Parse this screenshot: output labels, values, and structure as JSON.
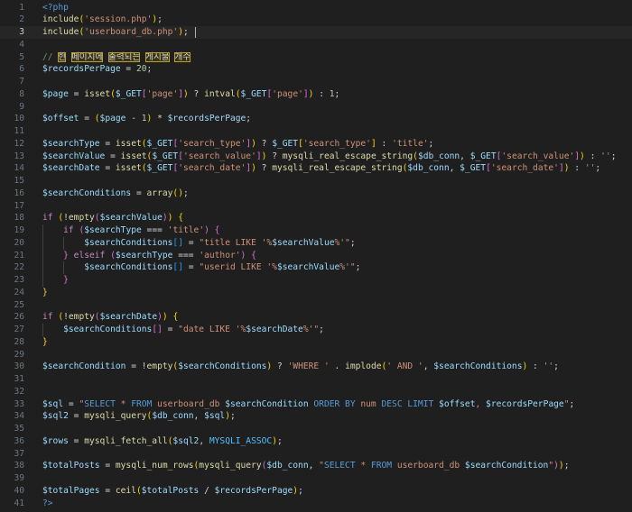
{
  "editor": {
    "language": "php",
    "current_line": 3,
    "line_count": 41,
    "lines": [
      [
        [
          "tag",
          "<?php"
        ]
      ],
      [
        [
          "fn",
          "include"
        ],
        [
          "br1",
          "("
        ],
        [
          "str",
          "'session.php'"
        ],
        [
          "br1",
          ")"
        ],
        [
          "op",
          ";"
        ]
      ],
      [
        [
          "fn",
          "include"
        ],
        [
          "br1",
          "("
        ],
        [
          "str",
          "'userboard_db.php'"
        ],
        [
          "br1",
          ")"
        ],
        [
          "op",
          ";"
        ]
      ],
      [],
      [
        [
          "cmt",
          "// "
        ],
        [
          "hl",
          "한"
        ],
        [
          "cmt",
          " "
        ],
        [
          "hl",
          "페이지에"
        ],
        [
          "cmt",
          " "
        ],
        [
          "hl",
          "출력되는"
        ],
        [
          "cmt",
          " "
        ],
        [
          "hl",
          "게시물"
        ],
        [
          "cmt",
          " "
        ],
        [
          "hl",
          "개수"
        ]
      ],
      [
        [
          "var",
          "$recordsPerPage"
        ],
        [
          "op",
          " = "
        ],
        [
          "num",
          "20"
        ],
        [
          "op",
          ";"
        ]
      ],
      [],
      [
        [
          "var",
          "$page"
        ],
        [
          "op",
          " = "
        ],
        [
          "fn",
          "isset"
        ],
        [
          "br1",
          "("
        ],
        [
          "var",
          "$_GET"
        ],
        [
          "br2",
          "["
        ],
        [
          "str",
          "'page'"
        ],
        [
          "br2",
          "]"
        ],
        [
          "br1",
          ")"
        ],
        [
          "op",
          " ? "
        ],
        [
          "fn",
          "intval"
        ],
        [
          "br1",
          "("
        ],
        [
          "var",
          "$_GET"
        ],
        [
          "br2",
          "["
        ],
        [
          "str",
          "'page'"
        ],
        [
          "br2",
          "]"
        ],
        [
          "br1",
          ")"
        ],
        [
          "op",
          " : "
        ],
        [
          "num",
          "1"
        ],
        [
          "op",
          ";"
        ]
      ],
      [],
      [
        [
          "var",
          "$offset"
        ],
        [
          "op",
          " = "
        ],
        [
          "br1",
          "("
        ],
        [
          "var",
          "$page"
        ],
        [
          "op",
          " - "
        ],
        [
          "num",
          "1"
        ],
        [
          "br1",
          ")"
        ],
        [
          "op",
          " * "
        ],
        [
          "var",
          "$recordsPerPage"
        ],
        [
          "op",
          ";"
        ]
      ],
      [],
      [
        [
          "var",
          "$searchType"
        ],
        [
          "op",
          " = "
        ],
        [
          "fn",
          "isset"
        ],
        [
          "br1",
          "("
        ],
        [
          "var",
          "$_GET"
        ],
        [
          "br2",
          "["
        ],
        [
          "str",
          "'search_type'"
        ],
        [
          "br2",
          "]"
        ],
        [
          "br1",
          ")"
        ],
        [
          "op",
          " ? "
        ],
        [
          "var",
          "$_GET"
        ],
        [
          "br1",
          "["
        ],
        [
          "str",
          "'search_type'"
        ],
        [
          "br1",
          "]"
        ],
        [
          "op",
          " : "
        ],
        [
          "str",
          "'title'"
        ],
        [
          "op",
          ";"
        ]
      ],
      [
        [
          "var",
          "$searchValue"
        ],
        [
          "op",
          " = "
        ],
        [
          "fn",
          "isset"
        ],
        [
          "br1",
          "("
        ],
        [
          "var",
          "$_GET"
        ],
        [
          "br2",
          "["
        ],
        [
          "str",
          "'search_value'"
        ],
        [
          "br2",
          "]"
        ],
        [
          "br1",
          ")"
        ],
        [
          "op",
          " ? "
        ],
        [
          "fn",
          "mysqli_real_escape_string"
        ],
        [
          "br1",
          "("
        ],
        [
          "var",
          "$db_conn"
        ],
        [
          "op",
          ", "
        ],
        [
          "var",
          "$_GET"
        ],
        [
          "br2",
          "["
        ],
        [
          "str",
          "'search_value'"
        ],
        [
          "br2",
          "]"
        ],
        [
          "br1",
          ")"
        ],
        [
          "op",
          " : "
        ],
        [
          "str",
          "''"
        ],
        [
          "op",
          ";"
        ]
      ],
      [
        [
          "var",
          "$searchDate"
        ],
        [
          "op",
          " = "
        ],
        [
          "fn",
          "isset"
        ],
        [
          "br1",
          "("
        ],
        [
          "var",
          "$_GET"
        ],
        [
          "br2",
          "["
        ],
        [
          "str",
          "'search_date'"
        ],
        [
          "br2",
          "]"
        ],
        [
          "br1",
          ")"
        ],
        [
          "op",
          " ? "
        ],
        [
          "fn",
          "mysqli_real_escape_string"
        ],
        [
          "br1",
          "("
        ],
        [
          "var",
          "$db_conn"
        ],
        [
          "op",
          ", "
        ],
        [
          "var",
          "$_GET"
        ],
        [
          "br2",
          "["
        ],
        [
          "str",
          "'search_date'"
        ],
        [
          "br2",
          "]"
        ],
        [
          "br1",
          ")"
        ],
        [
          "op",
          " : "
        ],
        [
          "str",
          "''"
        ],
        [
          "op",
          ";"
        ]
      ],
      [],
      [
        [
          "var",
          "$searchConditions"
        ],
        [
          "op",
          " = "
        ],
        [
          "fn",
          "array"
        ],
        [
          "br1",
          "()"
        ],
        [
          "op",
          ";"
        ]
      ],
      [],
      [
        [
          "kw",
          "if"
        ],
        [
          "op",
          " "
        ],
        [
          "br1",
          "("
        ],
        [
          "op",
          "!"
        ],
        [
          "fn",
          "empty"
        ],
        [
          "br2",
          "("
        ],
        [
          "var",
          "$searchValue"
        ],
        [
          "br2",
          ")"
        ],
        [
          "br1",
          ")"
        ],
        [
          "op",
          " "
        ],
        [
          "br1",
          "{"
        ]
      ],
      [
        [
          "op",
          "    "
        ],
        [
          "kw",
          "if"
        ],
        [
          "op",
          " "
        ],
        [
          "br2",
          "("
        ],
        [
          "var",
          "$searchType"
        ],
        [
          "op",
          " === "
        ],
        [
          "str",
          "'title'"
        ],
        [
          "br2",
          ")"
        ],
        [
          "op",
          " "
        ],
        [
          "br2",
          "{"
        ]
      ],
      [
        [
          "op",
          "        "
        ],
        [
          "var",
          "$searchConditions"
        ],
        [
          "br3",
          "[]"
        ],
        [
          "op",
          " = "
        ],
        [
          "str",
          "\"title LIKE '%"
        ],
        [
          "var",
          "$searchValue"
        ],
        [
          "str",
          "%'\""
        ],
        [
          "op",
          ";"
        ]
      ],
      [
        [
          "op",
          "    "
        ],
        [
          "br2",
          "}"
        ],
        [
          "op",
          " "
        ],
        [
          "kw",
          "elseif"
        ],
        [
          "op",
          " "
        ],
        [
          "br2",
          "("
        ],
        [
          "var",
          "$searchType"
        ],
        [
          "op",
          " === "
        ],
        [
          "str",
          "'author'"
        ],
        [
          "br2",
          ")"
        ],
        [
          "op",
          " "
        ],
        [
          "br2",
          "{"
        ]
      ],
      [
        [
          "op",
          "        "
        ],
        [
          "var",
          "$searchConditions"
        ],
        [
          "br3",
          "[]"
        ],
        [
          "op",
          " = "
        ],
        [
          "str",
          "\"userid LIKE '%"
        ],
        [
          "var",
          "$searchValue"
        ],
        [
          "str",
          "%'\""
        ],
        [
          "op",
          ";"
        ]
      ],
      [
        [
          "op",
          "    "
        ],
        [
          "br2",
          "}"
        ]
      ],
      [
        [
          "br1",
          "}"
        ]
      ],
      [],
      [
        [
          "kw",
          "if"
        ],
        [
          "op",
          " "
        ],
        [
          "br1",
          "("
        ],
        [
          "op",
          "!"
        ],
        [
          "fn",
          "empty"
        ],
        [
          "br2",
          "("
        ],
        [
          "var",
          "$searchDate"
        ],
        [
          "br2",
          ")"
        ],
        [
          "br1",
          ")"
        ],
        [
          "op",
          " "
        ],
        [
          "br1",
          "{"
        ]
      ],
      [
        [
          "op",
          "    "
        ],
        [
          "var",
          "$searchConditions"
        ],
        [
          "br2",
          "[]"
        ],
        [
          "op",
          " = "
        ],
        [
          "str",
          "\"date LIKE '%"
        ],
        [
          "var",
          "$searchDate"
        ],
        [
          "str",
          "%'\""
        ],
        [
          "op",
          ";"
        ]
      ],
      [
        [
          "br1",
          "}"
        ]
      ],
      [],
      [
        [
          "var",
          "$searchCondition"
        ],
        [
          "op",
          " = !"
        ],
        [
          "fn",
          "empty"
        ],
        [
          "br1",
          "("
        ],
        [
          "var",
          "$searchConditions"
        ],
        [
          "br1",
          ")"
        ],
        [
          "op",
          " ? "
        ],
        [
          "str",
          "'WHERE '"
        ],
        [
          "op",
          " . "
        ],
        [
          "fn",
          "implode"
        ],
        [
          "br1",
          "("
        ],
        [
          "str",
          "' AND '"
        ],
        [
          "op",
          ", "
        ],
        [
          "var",
          "$searchConditions"
        ],
        [
          "br1",
          ")"
        ],
        [
          "op",
          " : "
        ],
        [
          "str",
          "''"
        ],
        [
          "op",
          ";"
        ]
      ],
      [],
      [],
      [
        [
          "var",
          "$sql"
        ],
        [
          "op",
          " = "
        ],
        [
          "str",
          "\""
        ],
        [
          "sqlkw",
          "SELECT"
        ],
        [
          "str",
          " * "
        ],
        [
          "sqlkw",
          "FROM"
        ],
        [
          "str",
          " userboard_db "
        ],
        [
          "var",
          "$searchCondition"
        ],
        [
          "str",
          " "
        ],
        [
          "sqlkw",
          "ORDER BY"
        ],
        [
          "str",
          " num "
        ],
        [
          "sqlkw",
          "DESC LIMIT"
        ],
        [
          "str",
          " "
        ],
        [
          "var",
          "$offset"
        ],
        [
          "str",
          ", "
        ],
        [
          "var",
          "$recordsPerPage"
        ],
        [
          "str",
          "\""
        ],
        [
          "op",
          ";"
        ]
      ],
      [
        [
          "var",
          "$sql2"
        ],
        [
          "op",
          " = "
        ],
        [
          "fn",
          "mysqli_query"
        ],
        [
          "br1",
          "("
        ],
        [
          "var",
          "$db_conn"
        ],
        [
          "op",
          ", "
        ],
        [
          "var",
          "$sql"
        ],
        [
          "br1",
          ")"
        ],
        [
          "op",
          ";"
        ]
      ],
      [],
      [
        [
          "var",
          "$rows"
        ],
        [
          "op",
          " = "
        ],
        [
          "fn",
          "mysqli_fetch_all"
        ],
        [
          "br1",
          "("
        ],
        [
          "var",
          "$sql2"
        ],
        [
          "op",
          ", "
        ],
        [
          "const",
          "MYSQLI_ASSOC"
        ],
        [
          "br1",
          ")"
        ],
        [
          "op",
          ";"
        ]
      ],
      [],
      [
        [
          "var",
          "$totalPosts"
        ],
        [
          "op",
          " = "
        ],
        [
          "fn",
          "mysqli_num_rows"
        ],
        [
          "br1",
          "("
        ],
        [
          "fn",
          "mysqli_query"
        ],
        [
          "br2",
          "("
        ],
        [
          "var",
          "$db_conn"
        ],
        [
          "op",
          ", "
        ],
        [
          "str",
          "\""
        ],
        [
          "sqlkw",
          "SELECT"
        ],
        [
          "str",
          " * "
        ],
        [
          "sqlkw",
          "FROM"
        ],
        [
          "str",
          " userboard_db "
        ],
        [
          "var",
          "$searchCondition"
        ],
        [
          "str",
          "\""
        ],
        [
          "br2",
          ")"
        ],
        [
          "br1",
          ")"
        ],
        [
          "op",
          ";"
        ]
      ],
      [],
      [
        [
          "var",
          "$totalPages"
        ],
        [
          "op",
          " = "
        ],
        [
          "fn",
          "ceil"
        ],
        [
          "br1",
          "("
        ],
        [
          "var",
          "$totalPosts"
        ],
        [
          "op",
          " / "
        ],
        [
          "var",
          "$recordsPerPage"
        ],
        [
          "br1",
          ")"
        ],
        [
          "op",
          ";"
        ]
      ],
      [
        [
          "tag",
          "?>"
        ]
      ]
    ]
  }
}
